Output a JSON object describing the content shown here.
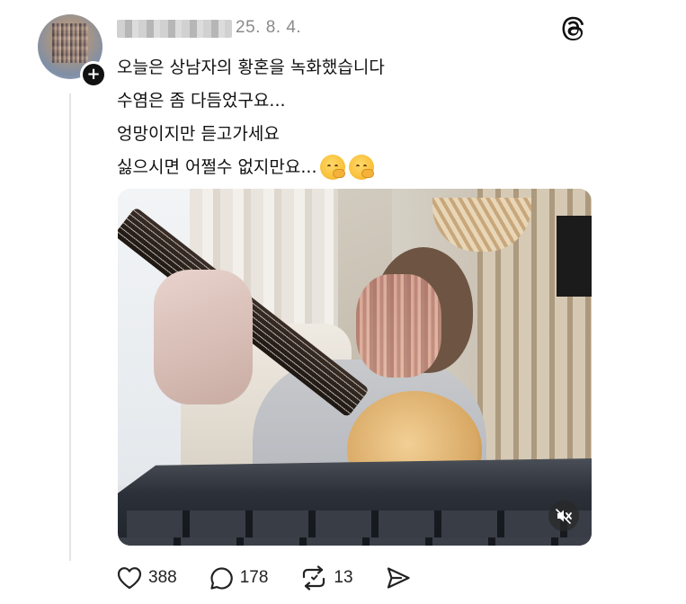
{
  "post": {
    "timestamp": "25. 8. 4.",
    "lines": [
      "오늘은 상남자의 황혼을 녹화했습니다",
      "수염은 좀 다듬었구요...",
      "엉망이지만 듣고가세요",
      "싫으시면 어쩔수 없지만요..."
    ],
    "emojis": [
      "melting-face-icon",
      "melting-face-icon"
    ]
  },
  "actions": {
    "likes": "388",
    "replies": "178",
    "reposts": "13"
  },
  "icons": {
    "brand": "threads-logo-icon",
    "follow": "plus-icon",
    "mute": "speaker-muted-icon",
    "like": "heart-icon",
    "reply": "speech-bubble-icon",
    "repost": "repost-icon",
    "share": "send-icon"
  },
  "colors": {
    "text": "#111111",
    "muted": "#8a8a8a",
    "thread_line": "#e4e4e4"
  }
}
